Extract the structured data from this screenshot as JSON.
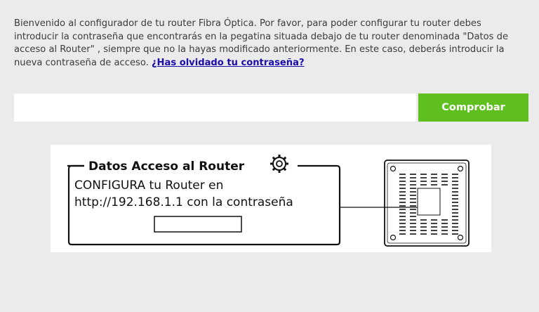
{
  "intro": {
    "text": "Bienvenido al configurador de tu router Fibra Óptica. Por favor, para poder configurar tu router debes introducir la contraseña que encontrarás en la pegatina situada debajo de tu router denominada \"Datos de acceso al Router\" , siempre que no la hayas modificado anteriormente. En este caso, deberás introducir la nueva contraseña de acceso.",
    "forgot_link": "¿Has olvidado tu contraseña?"
  },
  "password": {
    "value": "",
    "placeholder": ""
  },
  "buttons": {
    "check": "Comprobar"
  },
  "sticker": {
    "title": "Datos Acceso al Router",
    "line1": "CONFIGURA tu Router en",
    "line2": "http://192.168.1.1 con la contraseña",
    "icon": "gear-icon"
  },
  "colors": {
    "accent": "#5fbf1f",
    "link": "#1a0dab",
    "background": "#ebebeb"
  }
}
